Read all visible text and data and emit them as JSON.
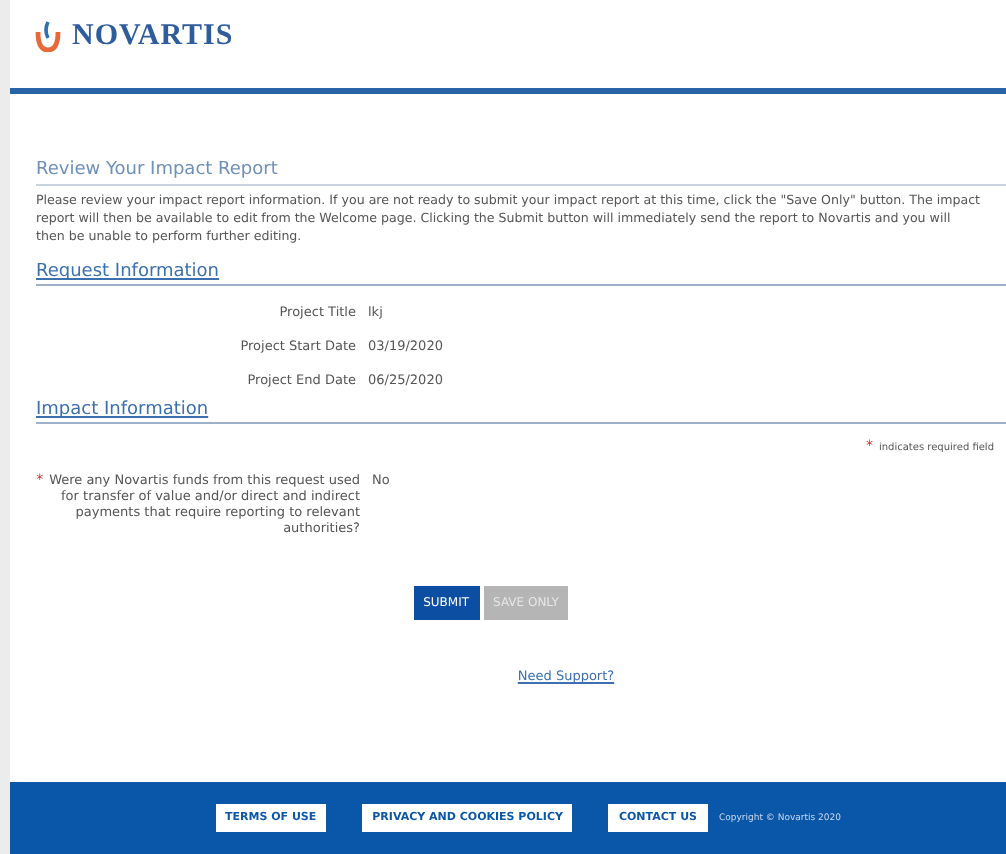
{
  "header": {
    "logo_text": "NOVARTIS"
  },
  "page_title": "Review Your Impact Report",
  "intro": "Please review your impact report information. If you are not ready to submit your impact report at this time, click the \"Save Only\" button. The impact report will then be available to edit from the Welcome page. Clicking the Submit button will immediately send the report to Novartis and you will then be unable to perform further editing.",
  "request_section": {
    "title": "Request Information",
    "fields": [
      {
        "label": "Project Title",
        "value": "lkj"
      },
      {
        "label": "Project Start Date",
        "value": "03/19/2020"
      },
      {
        "label": "Project End Date",
        "value": "06/25/2020"
      }
    ]
  },
  "impact_section": {
    "title": "Impact Information",
    "required_note": "indicates required field",
    "required_mark": "*",
    "fields": [
      {
        "label": "Were any Novartis funds from this request used for transfer of value and/or direct and indirect payments that require reporting to relevant authorities?",
        "value": "No",
        "required": true
      }
    ]
  },
  "buttons": [
    {
      "label": "SUBMIT",
      "disabled": false
    },
    {
      "label": "SAVE ONLY",
      "disabled": true
    }
  ],
  "support_link": "Need Support?",
  "footer": {
    "links": [
      "TERMS OF USE",
      "PRIVACY AND COOKIES POLICY",
      "CONTACT US"
    ],
    "copyright": "Copyright © Novartis 2020"
  }
}
